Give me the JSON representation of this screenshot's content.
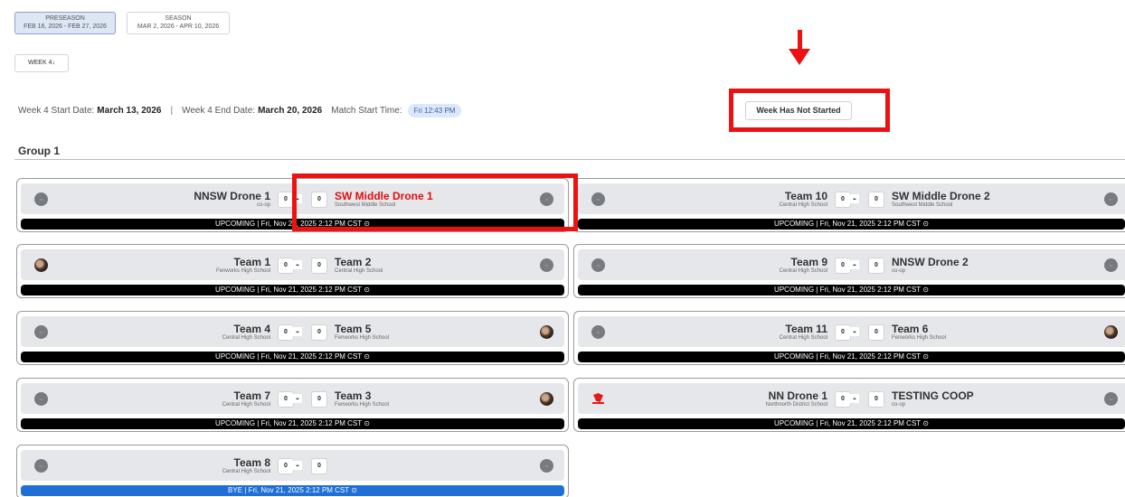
{
  "seasons": [
    {
      "label": "PRESEASON",
      "dates": "FEB 16, 2026 - FEB 27, 2026",
      "active": true
    },
    {
      "label": "SEASON",
      "dates": "MAR 2, 2026 - APR 10, 2026",
      "active": false
    }
  ],
  "week_selector": {
    "label": "WEEK 4↓"
  },
  "info": {
    "start_label": "Week 4 Start Date:",
    "start_value": "March 13, 2026",
    "separator": "|",
    "end_label": "Week 4 End Date:",
    "end_value": "March 20, 2026",
    "match_start_label": "Match Start Time:",
    "match_start_value": "Fri 12:43 PM"
  },
  "week_status": "Week Has Not Started",
  "group": {
    "title": "Group 1"
  },
  "colors": {
    "highlight": "#ee1111",
    "status_bar": "#000000",
    "bye_bar": "#1f6fd6",
    "panel": "#e6e7ea"
  },
  "matches": [
    {
      "home": {
        "name": "NNSW Drone 1",
        "school": "co-op",
        "score": "0",
        "logo": "team-logo-placeholder"
      },
      "away": {
        "name": "SW Middle Drone 1",
        "school": "Southwest Middle School",
        "score": "0",
        "logo": "team-logo-placeholder"
      },
      "dash": "-",
      "status": "UPCOMING | Fri, Nov 21, 2025 2:12 PM CST ⊙"
    },
    {
      "home": {
        "name": "Team 10",
        "school": "Central High School",
        "score": "0",
        "logo": "team-logo-placeholder"
      },
      "away": {
        "name": "SW Middle Drone 2",
        "school": "Southwest Middle School",
        "score": "0",
        "logo": "team-logo-placeholder"
      },
      "dash": "-",
      "status": "UPCOMING | Fri, Nov 21, 2025 2:12 PM CST ⊙"
    },
    {
      "home": {
        "name": "Team 1",
        "school": "Fenworks High School",
        "score": "0",
        "logo": "team-logo-photo"
      },
      "away": {
        "name": "Team 2",
        "school": "Central High School",
        "score": "0",
        "logo": "team-logo-placeholder"
      },
      "dash": "-",
      "status": "UPCOMING | Fri, Nov 21, 2025 2:12 PM CST ⊙"
    },
    {
      "home": {
        "name": "Team 9",
        "school": "Central High School",
        "score": "0",
        "logo": "team-logo-placeholder"
      },
      "away": {
        "name": "NNSW Drone 2",
        "school": "co-op",
        "score": "0",
        "logo": "team-logo-placeholder"
      },
      "dash": "-",
      "status": "UPCOMING | Fri, Nov 21, 2025 2:12 PM CST ⊙"
    },
    {
      "home": {
        "name": "Team 4",
        "school": "Central High School",
        "score": "0",
        "logo": "team-logo-placeholder"
      },
      "away": {
        "name": "Team 5",
        "school": "Fenworks High School",
        "score": "0",
        "logo": "team-logo-photo"
      },
      "dash": "-",
      "status": "UPCOMING | Fri, Nov 21, 2025 2:12 PM CST ⊙"
    },
    {
      "home": {
        "name": "Team 11",
        "school": "Central High School",
        "score": "0",
        "logo": "team-logo-placeholder"
      },
      "away": {
        "name": "Team 6",
        "school": "Fenworks High School",
        "score": "0",
        "logo": "team-logo-photo"
      },
      "dash": "-",
      "status": "UPCOMING | Fri, Nov 21, 2025 2:12 PM CST ⊙"
    },
    {
      "home": {
        "name": "Team 7",
        "school": "Central High School",
        "score": "0",
        "logo": "team-logo-placeholder"
      },
      "away": {
        "name": "Team 3",
        "school": "Fenworks High School",
        "score": "0",
        "logo": "team-logo-photo"
      },
      "dash": "-",
      "status": "UPCOMING | Fri, Nov 21, 2025 2:12 PM CST ⊙"
    },
    {
      "home": {
        "name": "NN Drone 1",
        "school": "Northnorth District School",
        "score": "0",
        "logo": "school-logo-red"
      },
      "away": {
        "name": "TESTING COOP",
        "school": "co-op",
        "score": "0",
        "logo": "team-logo-placeholder"
      },
      "dash": "-",
      "status": "UPCOMING | Fri, Nov 21, 2025 2:12 PM CST ⊙"
    },
    {
      "home": {
        "name": "Team 8",
        "school": "Central High School",
        "score": "0",
        "logo": "team-logo-placeholder"
      },
      "away": {
        "name": "",
        "school": "",
        "score": "0",
        "logo": "team-logo-placeholder"
      },
      "dash": "-",
      "status": "BYE | Fri, Nov 21, 2025 2:12 PM CST ⊙"
    }
  ]
}
